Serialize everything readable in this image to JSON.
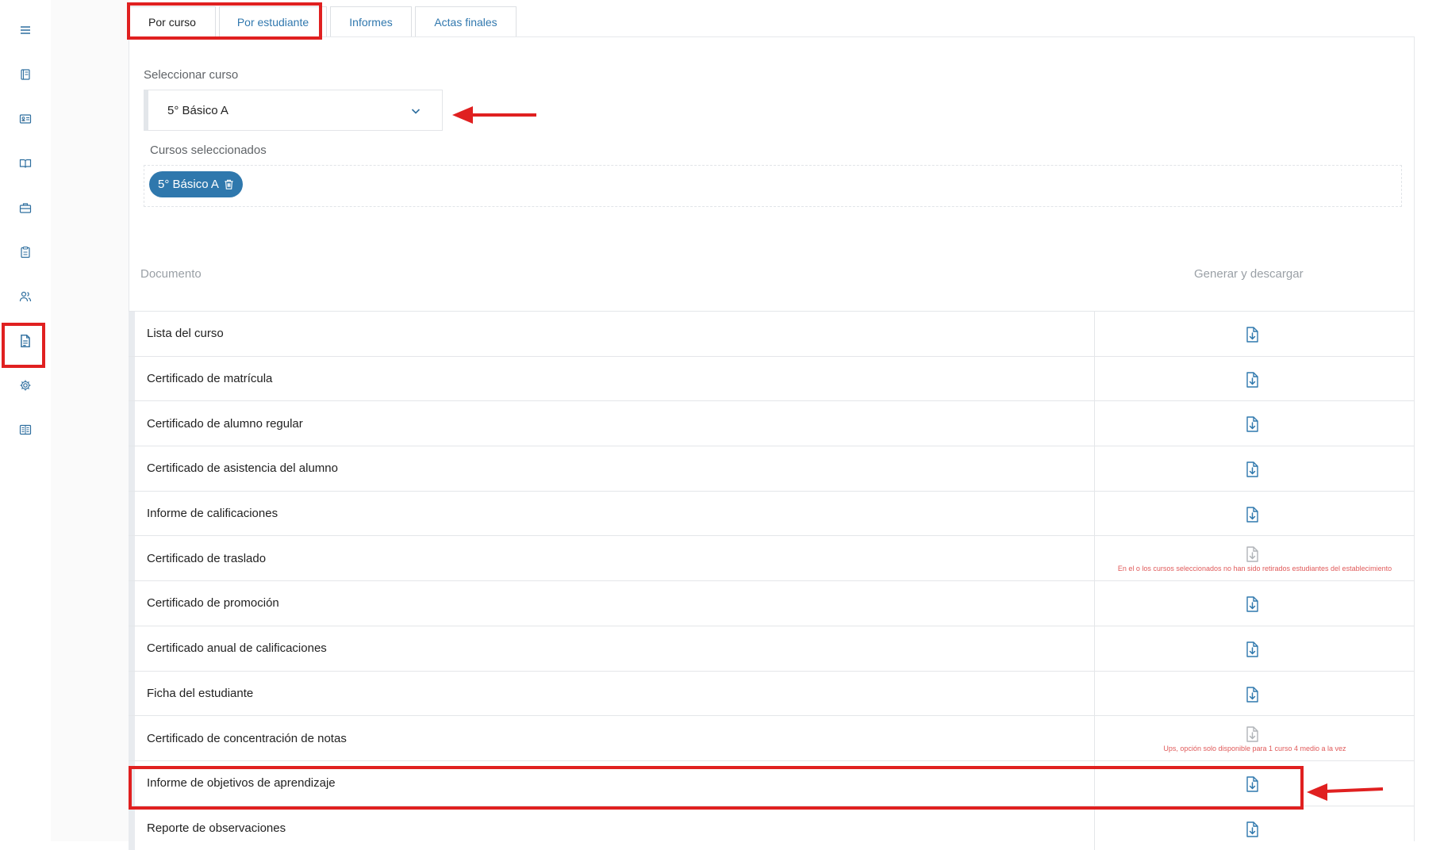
{
  "sidebar": {
    "items": [
      {
        "icon": "menu-icon"
      },
      {
        "icon": "notebook-icon"
      },
      {
        "icon": "id-card-icon"
      },
      {
        "icon": "open-book-icon"
      },
      {
        "icon": "briefcase-icon"
      },
      {
        "icon": "clipboard-icon"
      },
      {
        "icon": "users-icon"
      },
      {
        "icon": "document-icon",
        "active": true
      },
      {
        "icon": "gear-icon"
      },
      {
        "icon": "book-columns-icon"
      }
    ]
  },
  "tabs": [
    {
      "label": "Por curso",
      "active": true
    },
    {
      "label": "Por estudiante"
    },
    {
      "label": "Informes"
    },
    {
      "label": "Actas finales"
    }
  ],
  "course_select": {
    "label": "Seleccionar curso",
    "value": "5° Básico A"
  },
  "selected_courses": {
    "label": "Cursos seleccionados",
    "chips": [
      "5° Básico A"
    ]
  },
  "table": {
    "col_document": "Documento",
    "col_generate": "Generar y descargar",
    "rows": [
      {
        "name": "Lista del curso"
      },
      {
        "name": "Certificado de matrícula"
      },
      {
        "name": "Certificado de alumno regular"
      },
      {
        "name": "Certificado de asistencia del alumno"
      },
      {
        "name": "Informe de calificaciones"
      },
      {
        "name": "Certificado de traslado",
        "disabled": true,
        "message": "En el o los cursos seleccionados no han sido retirados estudiantes del establecimiento"
      },
      {
        "name": "Certificado de promoción"
      },
      {
        "name": "Certificado anual de calificaciones"
      },
      {
        "name": "Ficha del estudiante"
      },
      {
        "name": "Certificado de concentración de notas",
        "disabled": true,
        "message": "Ups, opción solo disponible para 1 curso 4 medio a la vez"
      },
      {
        "name": "Informe de objetivos de aprendizaje"
      },
      {
        "name": "Reporte de observaciones"
      }
    ]
  },
  "colors": {
    "accent": "#2f78ad",
    "annotation": "#e02020",
    "error_text": "#e05a5a",
    "icon": "#2f78ad",
    "icon_disabled": "#b0b4b8"
  }
}
